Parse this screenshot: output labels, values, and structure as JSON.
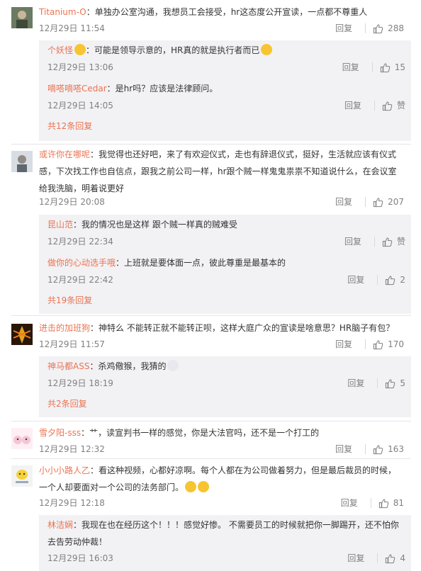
{
  "comments": [
    {
      "user": "Titanium-O",
      "text": "：单独办公室沟通，我想员工会接受，hr这态度公开宣读，一点都不尊重人",
      "time": "12月29日 11:54",
      "reply": "回复",
      "likes": "288",
      "replies": [
        {
          "user": "个妖怪",
          "text": "：可能是领导示意的，HR真的就是执行者而已",
          "time": "12月29日 13:06",
          "reply": "回复",
          "likes": "15"
        },
        {
          "user": "嘀嗒嘀嗒Cedar",
          "text": "：是hr吗？应该是法律顾问。",
          "time": "12月29日 14:05",
          "reply": "回复",
          "likes": "赞"
        }
      ],
      "more": "共12条回复"
    },
    {
      "user": "或许你在哪呢",
      "text": "：我觉得也还好吧，来了有欢迎仪式，走也有辞退仪式，挺好，生活就应该有仪式感，下次找工作也自信点，跟我之前公司一样，hr跟个贼一样鬼鬼祟祟不知道说什么，在会议室给我洗脑，明着说更好",
      "time": "12月29日 20:08",
      "reply": "回复",
      "likes": "207",
      "replies": [
        {
          "user": "昆山范",
          "text": "：我的情况也是这样 跟个贼一样真的贼难受",
          "time": "12月29日 22:34",
          "reply": "回复",
          "likes": "赞"
        },
        {
          "user": "做你的心动选手哦",
          "text": "：上班就是要体面一点，彼此尊重是最基本的",
          "time": "12月29日 22:42",
          "reply": "回复",
          "likes": "2"
        }
      ],
      "more": "共19条回复"
    },
    {
      "user": "进击的加班狗",
      "text": "：神特么 不能转正就不能转正呗，这样大庭广众的宣读是啥意思？HR脑子有包？",
      "time": "12月29日 11:57",
      "reply": "回复",
      "likes": "170",
      "replies": [
        {
          "user": "神马都ASS",
          "text": "：杀鸡儆猴，我猜的",
          "time": "12月29日 18:19",
          "reply": "回复",
          "likes": "5"
        }
      ],
      "more": "共2条回复"
    },
    {
      "user": "雪夕阳-sss",
      "text": "：艹，读宣判书一样的感觉，你是大法官吗，还不是一个打工的",
      "time": "12月29日 12:32",
      "reply": "回复",
      "likes": "163"
    },
    {
      "user": "小小小路人乙",
      "text": "：看这种视频，心都好凉啊。每个人都在为公司做着努力，但是最后裁员的时候，一个人却要面对一个公司的法务部门。",
      "time": "12月29日 12:18",
      "reply": "回复",
      "likes": "81",
      "replies": [
        {
          "user": "林洁娴",
          "text": "：我现在也在经历这个！！！感觉好惨。 不需要员工的时候就把你一脚踢开，还不怕你去告劳动仲裁！",
          "time": "12月29日 16:03",
          "reply": "回复",
          "likes": "4"
        }
      ]
    }
  ],
  "colors": {
    "username": "#eb7350",
    "meta": "#808080",
    "subbg": "#f2f2f5"
  }
}
